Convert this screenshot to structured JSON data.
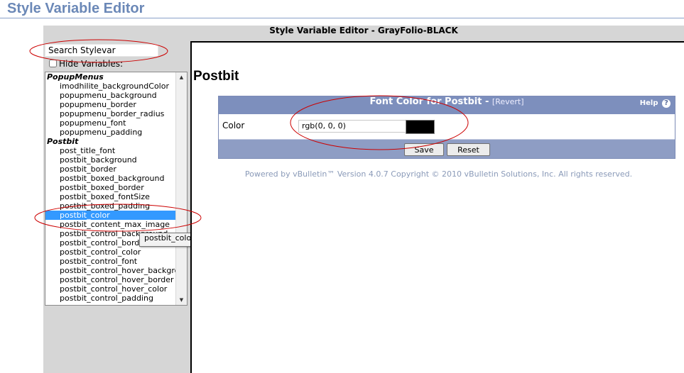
{
  "page": {
    "title": "Style Variable Editor"
  },
  "window": {
    "title": "Style Variable Editor - GrayFolio-BLACK"
  },
  "sidebar": {
    "search_value": "Search Stylevar",
    "hide_label": "Hide Variables:",
    "groups": [
      {
        "label": "PopupMenus",
        "items": [
          "imodhilite_backgroundColor",
          "popupmenu_background",
          "popupmenu_border",
          "popupmenu_border_radius",
          "popupmenu_font",
          "popupmenu_padding"
        ]
      },
      {
        "label": "Postbit",
        "items": [
          "post_title_font",
          "postbit_background",
          "postbit_border",
          "postbit_boxed_background",
          "postbit_boxed_border",
          "postbit_boxed_fontSize",
          "postbit_boxed_padding",
          "postbit_color",
          "postbit_content_max_image",
          "postbit_control_background",
          "postbit_control_border",
          "postbit_control_color",
          "postbit_control_font",
          "postbit_control_hover_background",
          "postbit_control_hover_border",
          "postbit_control_hover_color",
          "postbit_control_padding"
        ]
      }
    ],
    "selected": "postbit_color",
    "tooltip": "postbit_color"
  },
  "main": {
    "section_title": "Postbit",
    "box": {
      "heading": "Font Color for Postbit",
      "heading_sep": "-",
      "revert": "[Revert]",
      "help": "Help",
      "help_glyph": "?",
      "field_label": "Color",
      "field_value": "rgb(0, 0, 0)",
      "swatch_color": "#000000",
      "save": "Save",
      "reset": "Reset"
    },
    "copyright": "Powered by vBulletin™ Version 4.0.7 Copyright © 2010 vBulletin Solutions, Inc. All rights reserved."
  },
  "colors": {
    "accent": "#6b88b7",
    "header_bg": "#7d8fbd",
    "selection": "#3399ff",
    "annotation": "#cc0000"
  }
}
